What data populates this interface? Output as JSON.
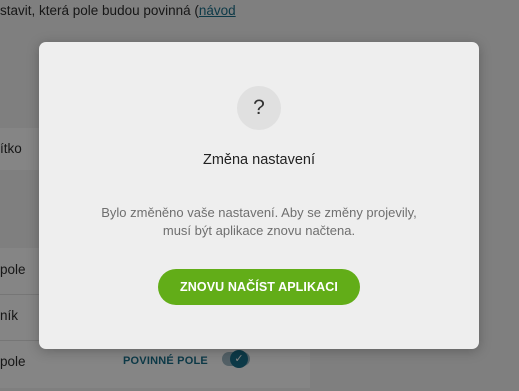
{
  "background": {
    "intro_text": "stavit, která pole budou povinná (",
    "intro_link": "návod",
    "card_label": "ítko",
    "rows": [
      {
        "label": "pole"
      },
      {
        "label": "ník"
      },
      {
        "label": "pole"
      }
    ],
    "required_label": "POVINNÉ POLE",
    "toggle_check": "✓"
  },
  "dialog": {
    "icon_glyph": "?",
    "title": "Změna nastavení",
    "message_line1": "Bylo změněno vaše nastavení. Aby se změny projevily,",
    "message_line2": "musí být aplikace znovu načtena.",
    "button_label": "ZNOVU NAČÍST APLIKACI"
  },
  "colors": {
    "button": "#62ad18",
    "overlay": "rgba(0,0,0,0.48)",
    "link": "#1a6f8a"
  }
}
